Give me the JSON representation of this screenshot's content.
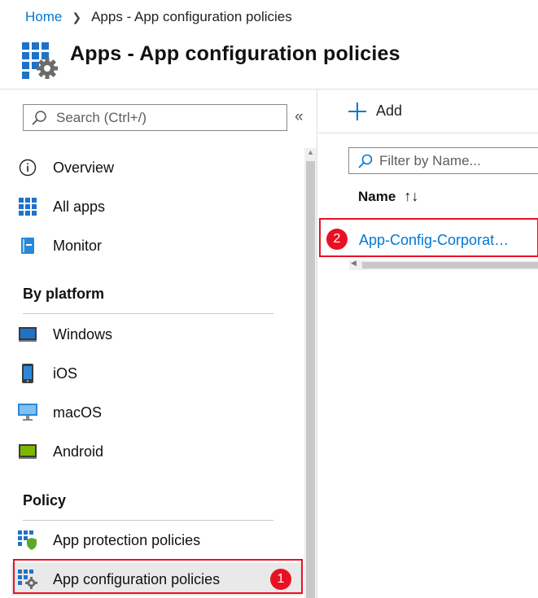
{
  "breadcrumb": {
    "home": "Home",
    "current": "Apps - App configuration policies"
  },
  "header": {
    "title": "Apps - App configuration policies",
    "icon": "apps-config-gear-icon"
  },
  "sidebar": {
    "search_placeholder": "Search (Ctrl+/)",
    "collapse_glyph": "«",
    "items": [
      {
        "label": "Overview",
        "icon": "info-icon"
      },
      {
        "label": "All apps",
        "icon": "grid-icon"
      },
      {
        "label": "Monitor",
        "icon": "monitor-book-icon"
      }
    ],
    "sections": [
      {
        "title": "By platform",
        "items": [
          {
            "label": "Windows",
            "icon": "windows-device-icon"
          },
          {
            "label": "iOS",
            "icon": "phone-icon"
          },
          {
            "label": "macOS",
            "icon": "imac-icon"
          },
          {
            "label": "Android",
            "icon": "android-device-icon"
          }
        ]
      },
      {
        "title": "Policy",
        "items": [
          {
            "label": "App protection policies",
            "icon": "app-protection-shield-icon"
          },
          {
            "label": "App configuration policies",
            "icon": "app-config-gear-icon",
            "selected": true
          }
        ]
      }
    ]
  },
  "main": {
    "add_label": "Add",
    "filter_placeholder": "Filter by Name...",
    "column_header": "Name",
    "sort_glyph": "↑↓",
    "rows": [
      {
        "name": "App-Config-Corporat…"
      }
    ]
  },
  "annotations": {
    "badge1": "1",
    "badge2": "2"
  },
  "colors": {
    "accent": "#0078d4",
    "annotation_red": "#e81123",
    "selected_bg": "#e9e9e9"
  }
}
